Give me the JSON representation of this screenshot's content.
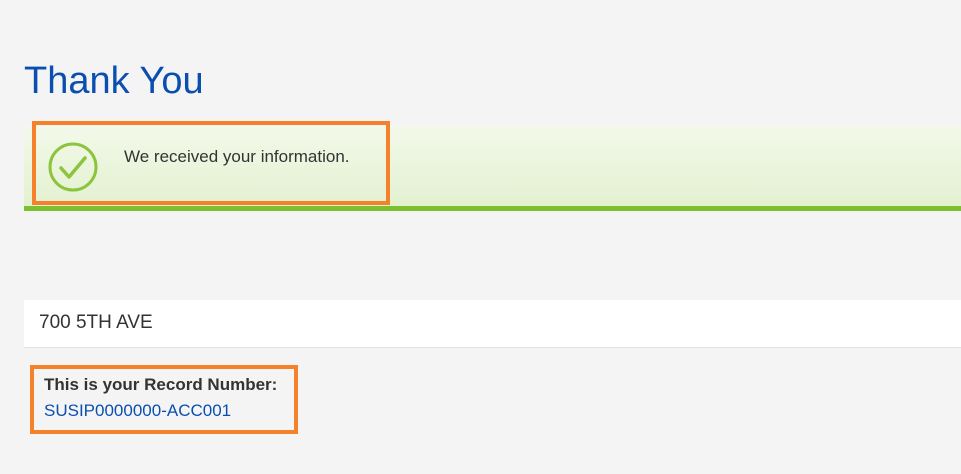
{
  "page": {
    "title": "Thank You"
  },
  "confirmation": {
    "icon": "check-circle-icon",
    "message": "We received your information.",
    "accent_color": "#7dc02f"
  },
  "address": {
    "line": "700 5TH AVE"
  },
  "record": {
    "label": "This is your Record Number:",
    "number": "SUSIP0000000-ACC001"
  },
  "colors": {
    "title": "#0a4faf",
    "link": "#0a4faf",
    "highlight": "#f5822a",
    "background": "#f4f4f4"
  }
}
